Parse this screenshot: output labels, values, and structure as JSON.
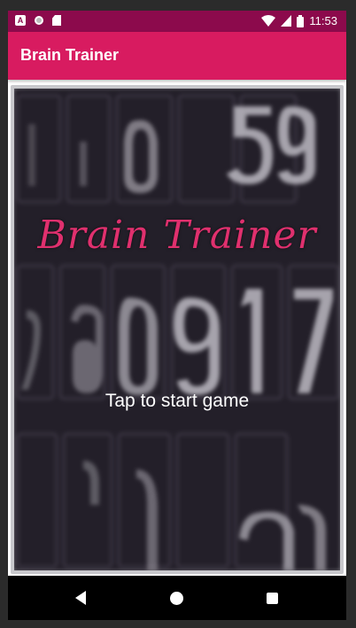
{
  "status_bar": {
    "time": "11:53",
    "icons": [
      "a-notification-icon",
      "circle-notification-icon",
      "sd-card-icon",
      "wifi-icon",
      "cell-signal-icon",
      "battery-icon"
    ],
    "background": "#8c0a4c"
  },
  "app_bar": {
    "title": "Brain Trainer",
    "background": "#d81b60"
  },
  "start_screen": {
    "logo_text": "Brain Trainer",
    "tap_prompt": "Tap to start game",
    "logo_color": "#e0306e"
  },
  "nav_bar": {
    "buttons": [
      "back-icon",
      "home-icon",
      "recents-icon"
    ]
  }
}
